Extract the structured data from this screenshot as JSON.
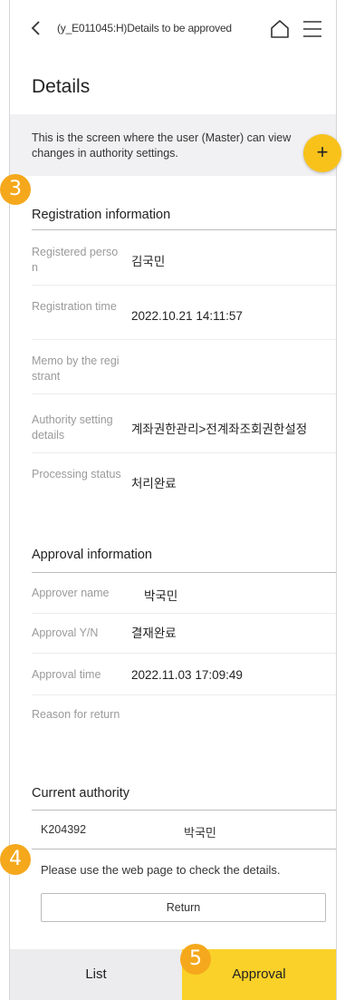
{
  "header": {
    "title": "(y_E011045:H)Details to be approved",
    "back_icon": "chevron-left-icon",
    "home_icon": "home-icon",
    "menu_icon": "hamburger-menu-icon"
  },
  "page": {
    "title": "Details",
    "notice": "This is the screen where the user (Master) can view changes in authority settings.",
    "fab_label": "+"
  },
  "steps": {
    "step3": "3",
    "step4": "4",
    "step5": "5"
  },
  "registration": {
    "title": "Registration information",
    "rows": [
      {
        "label": "Registered person",
        "value": "김국민"
      },
      {
        "label": "Registration time",
        "value": "2022.10.21 14:11:57"
      },
      {
        "label": "Memo by the registrant",
        "value": ""
      },
      {
        "label": "Authority setting details",
        "value": "계좌권한관리>전계좌조회권한설정"
      },
      {
        "label": "Processing status",
        "value": "처리완료"
      }
    ]
  },
  "approval": {
    "title": "Approval information",
    "rows": [
      {
        "label": "Approver name",
        "value": "박국민"
      },
      {
        "label": "Approval Y/N",
        "value": "결재완료"
      },
      {
        "label": "Approval time",
        "value": "2022.11.03 17:09:49"
      },
      {
        "label": "Reason for return",
        "value": ""
      }
    ]
  },
  "current_authority": {
    "title": "Current authority",
    "code": "K204392",
    "name": "박국민"
  },
  "footer": {
    "web_note": "Please use the web page to check the details.",
    "return_label": "Return",
    "list_label": "List",
    "approval_label": "Approval"
  },
  "colors": {
    "accent_yellow": "#fad128",
    "step_orange": "#f5a81c",
    "fab_yellow": "#f8c21b"
  }
}
